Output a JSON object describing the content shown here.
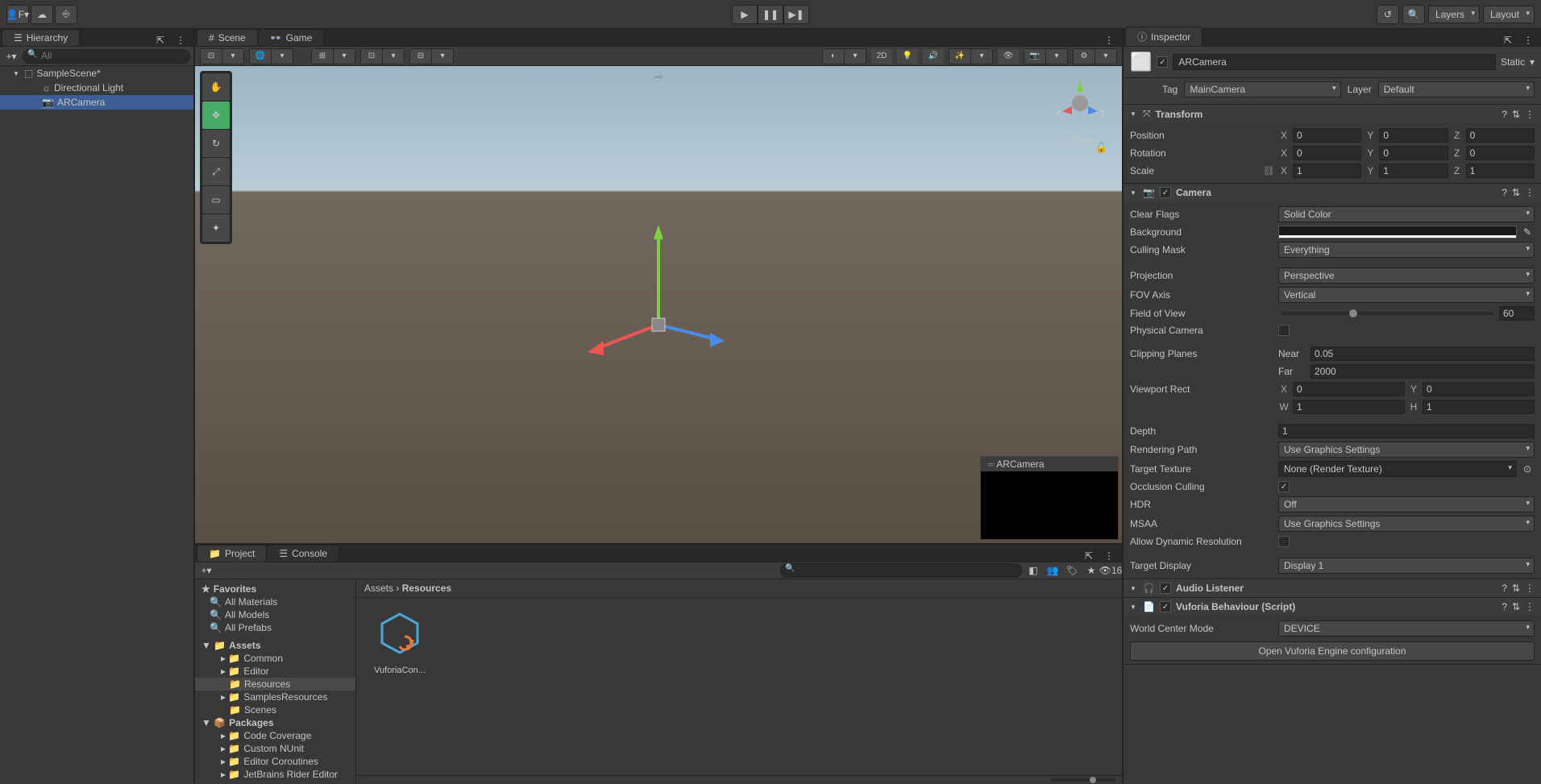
{
  "topbar": {
    "account_label": "F",
    "layers_label": "Layers",
    "layout_label": "Layout"
  },
  "hierarchy": {
    "title": "Hierarchy",
    "search_placeholder": "All",
    "scene_name": "SampleScene*",
    "items": [
      {
        "name": "Directional Light"
      },
      {
        "name": "ARCamera"
      }
    ]
  },
  "scene": {
    "tab_scene": "Scene",
    "tab_game": "Game",
    "mode_2d": "2D",
    "persp_label": "Persp",
    "camera_preview_title": "ARCamera"
  },
  "project": {
    "tab_project": "Project",
    "tab_console": "Console",
    "hidden_count": "16",
    "favorites_label": "Favorites",
    "fav_items": [
      "All Materials",
      "All Models",
      "All Prefabs"
    ],
    "assets_label": "Assets",
    "asset_folders": [
      "Common",
      "Editor",
      "Resources",
      "SamplesResources",
      "Scenes"
    ],
    "packages_label": "Packages",
    "package_folders": [
      "Code Coverage",
      "Custom NUnit",
      "Editor Coroutines",
      "JetBrains Rider Editor"
    ],
    "breadcrumb_root": "Assets",
    "breadcrumb_sep": "›",
    "breadcrumb_current": "Resources",
    "asset_name": "VuforiaCon..."
  },
  "inspector": {
    "title": "Inspector",
    "object_name": "ARCamera",
    "static_label": "Static",
    "tag_label": "Tag",
    "tag_value": "MainCamera",
    "layer_label": "Layer",
    "layer_value": "Default",
    "transform": {
      "title": "Transform",
      "position_label": "Position",
      "rotation_label": "Rotation",
      "scale_label": "Scale",
      "pos": {
        "x": "0",
        "y": "0",
        "z": "0"
      },
      "rot": {
        "x": "0",
        "y": "0",
        "z": "0"
      },
      "scale": {
        "x": "1",
        "y": "1",
        "z": "1"
      }
    },
    "camera": {
      "title": "Camera",
      "clear_flags_label": "Clear Flags",
      "clear_flags_value": "Solid Color",
      "background_label": "Background",
      "culling_mask_label": "Culling Mask",
      "culling_mask_value": "Everything",
      "projection_label": "Projection",
      "projection_value": "Perspective",
      "fov_axis_label": "FOV Axis",
      "fov_axis_value": "Vertical",
      "fov_label": "Field of View",
      "fov_value": "60",
      "physical_label": "Physical Camera",
      "clipping_label": "Clipping Planes",
      "near_label": "Near",
      "near_value": "0.05",
      "far_label": "Far",
      "far_value": "2000",
      "viewport_label": "Viewport Rect",
      "vp_x": "0",
      "vp_y": "0",
      "vp_w": "1",
      "vp_h": "1",
      "depth_label": "Depth",
      "depth_value": "1",
      "rendering_path_label": "Rendering Path",
      "rendering_path_value": "Use Graphics Settings",
      "target_texture_label": "Target Texture",
      "target_texture_value": "None (Render Texture)",
      "occlusion_label": "Occlusion Culling",
      "hdr_label": "HDR",
      "hdr_value": "Off",
      "msaa_label": "MSAA",
      "msaa_value": "Use Graphics Settings",
      "dynamic_res_label": "Allow Dynamic Resolution",
      "target_display_label": "Target Display",
      "target_display_value": "Display 1"
    },
    "audio_listener": {
      "title": "Audio Listener"
    },
    "vuforia": {
      "title": "Vuforia Behaviour (Script)",
      "world_center_label": "World Center Mode",
      "world_center_value": "DEVICE",
      "config_button": "Open Vuforia Engine configuration"
    }
  }
}
